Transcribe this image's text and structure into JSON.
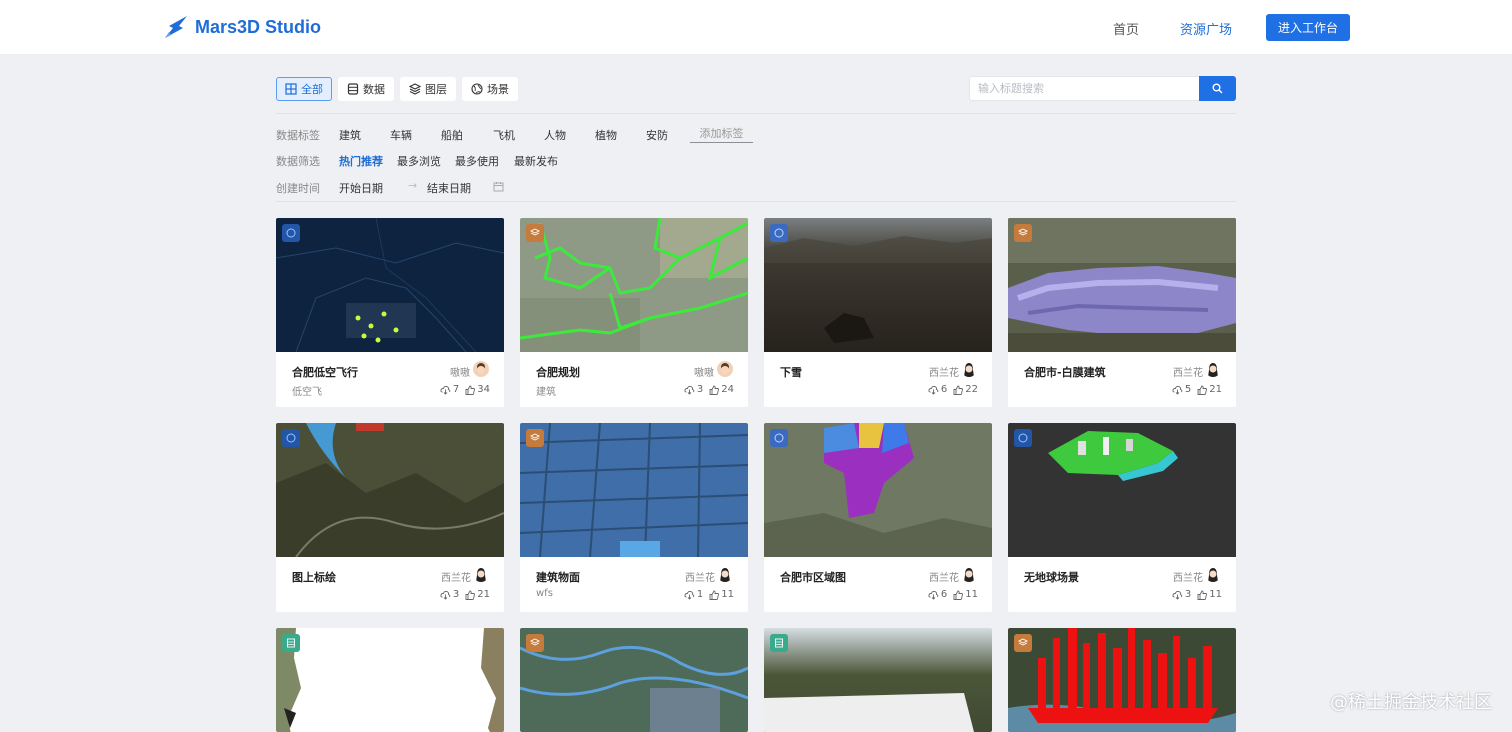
{
  "header": {
    "brand": "Mars3D Studio",
    "nav": [
      {
        "label": "首页"
      },
      {
        "label": "资源广场"
      }
    ],
    "enter_label": "进入工作台",
    "brand_color": "#1f6dd6"
  },
  "type_tabs": [
    {
      "label": "全部",
      "icon": "grid-icon",
      "active": true
    },
    {
      "label": "数据",
      "icon": "database-icon",
      "active": false
    },
    {
      "label": "图层",
      "icon": "layers-icon",
      "active": false
    },
    {
      "label": "场景",
      "icon": "globe-icon",
      "active": false
    }
  ],
  "search": {
    "placeholder": "输入标题搜索",
    "icon": "search-icon"
  },
  "filters": {
    "tags_label": "数据标签",
    "tags": [
      "建筑",
      "车辆",
      "船舶",
      "飞机",
      "人物",
      "植物",
      "安防"
    ],
    "add_tag": "添加标签",
    "sort_label": "数据筛选",
    "sorts": [
      {
        "label": "热门推荐",
        "active": true
      },
      {
        "label": "最多浏览",
        "active": false
      },
      {
        "label": "最多使用",
        "active": false
      },
      {
        "label": "最新发布",
        "active": false
      }
    ],
    "date_label": "创建时间",
    "start_placeholder": "开始日期",
    "end_placeholder": "结束日期"
  },
  "cards": [
    {
      "title": "合肥低空飞行",
      "tag": "低空飞",
      "author": "嗷嗷",
      "downloads": "7",
      "likes": "34",
      "badge": "globe-icon"
    },
    {
      "title": "合肥规划",
      "tag": "建筑",
      "author": "嗷嗷",
      "downloads": "3",
      "likes": "24",
      "badge": "layers-icon"
    },
    {
      "title": "下雪",
      "tag": "",
      "author": "西兰花",
      "downloads": "6",
      "likes": "22",
      "badge": "globe-icon"
    },
    {
      "title": "合肥市-白膜建筑",
      "tag": "",
      "author": "西兰花",
      "downloads": "5",
      "likes": "21",
      "badge": "layers-icon"
    },
    {
      "title": "图上标绘",
      "tag": "",
      "author": "西兰花",
      "downloads": "3",
      "likes": "21",
      "badge": "globe-icon"
    },
    {
      "title": "建筑物面",
      "tag": "wfs",
      "author": "西兰花",
      "downloads": "1",
      "likes": "11",
      "badge": "layers-icon"
    },
    {
      "title": "合肥市区域图",
      "tag": "",
      "author": "西兰花",
      "downloads": "6",
      "likes": "11",
      "badge": "globe-icon"
    },
    {
      "title": "无地球场景",
      "tag": "",
      "author": "西兰花",
      "downloads": "3",
      "likes": "11",
      "badge": "globe-icon"
    },
    {
      "title": "",
      "tag": "",
      "author": "",
      "downloads": "",
      "likes": "",
      "badge": "database-icon"
    },
    {
      "title": "",
      "tag": "",
      "author": "",
      "downloads": "",
      "likes": "",
      "badge": "layers-icon"
    },
    {
      "title": "",
      "tag": "",
      "author": "",
      "downloads": "",
      "likes": "",
      "badge": "database-icon"
    },
    {
      "title": "",
      "tag": "",
      "author": "",
      "downloads": "",
      "likes": "",
      "badge": "layers-icon"
    }
  ],
  "watermark": "@稀土掘金技术社区"
}
